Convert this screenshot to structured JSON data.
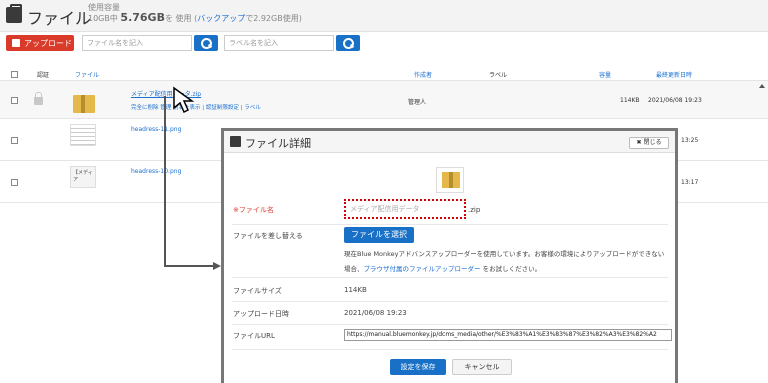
{
  "header": {
    "title": "ファイル",
    "usage_label": "使用容量",
    "usage_prefix": "10GB中",
    "usage_value": "5.76GB",
    "usage_middle": "を 使用 (",
    "backup_link": "バックアップ",
    "usage_suffix": "で2.92GB使用)"
  },
  "toolbar": {
    "upload_label": "アップロード",
    "filename_placeholder": "ファイル名を記入",
    "label_placeholder": "ラベル名を記入"
  },
  "table": {
    "columns": [
      "認証",
      "ファイル",
      "作成者",
      "ラベル",
      "容量",
      "最終更新日時"
    ],
    "rows": [
      {
        "name": "メディア配信用データ.zip",
        "actions": "完全に削除 管理 別名を表示 | 認証制限設定 | ラベル",
        "creator": "管理人",
        "size": "114KB",
        "updated": "2021/06/08 19:23"
      },
      {
        "name": "headress-11.png",
        "updated": "13:25"
      },
      {
        "name": "headress-10.png",
        "thumb_text": "【メディア",
        "updated": "13:17"
      }
    ]
  },
  "modal": {
    "title": "ファイル詳細",
    "close_label": "閉じる",
    "filename_label": "※ファイル名",
    "filename_value": "メディア配信用データ",
    "filename_ext": ".zip",
    "replace_label": "ファイルを差し替える",
    "choose_button": "ファイルを選択",
    "note_main": "現在Blue Monkeyアドバンスアップローダーを使用しています。お客様の環境によりアップロードができない場合、",
    "note_link": "ブラウザ付属のファイルアップローダー",
    "note_tail": "をお試しください。",
    "size_label": "ファイルサイズ",
    "size_value": "114KB",
    "upload_date_label": "アップロード日時",
    "upload_date_value": "2021/06/08 19:23",
    "url_label": "ファイルURL",
    "url_value": "https://manual.bluemonkey.jp/dcms_media/other/%E3%83%A1%E3%83%87%E3%82%A3%E3%82%A2",
    "save_button": "設定を保存",
    "cancel_button": "キャンセル"
  }
}
